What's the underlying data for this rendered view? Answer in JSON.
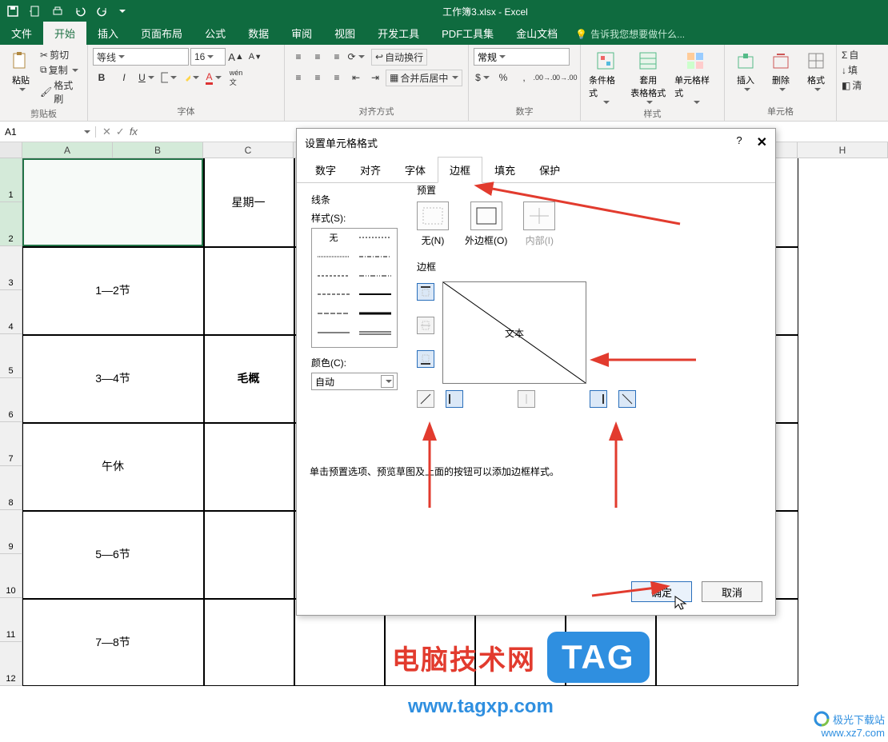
{
  "app": {
    "title": "工作簿3.xlsx - Excel"
  },
  "menutabs": {
    "file": "文件",
    "home": "开始",
    "insert": "插入",
    "pagelayout": "页面布局",
    "formulas": "公式",
    "data": "数据",
    "review": "审阅",
    "view": "视图",
    "dev": "开发工具",
    "pdf": "PDF工具集",
    "jinshan": "金山文档",
    "tell": "告诉我您想要做什么..."
  },
  "ribbon": {
    "clipboard": {
      "label": "剪贴板",
      "paste": "粘贴",
      "cut": "剪切",
      "copy": "复制",
      "brush": "格式刷"
    },
    "font": {
      "label": "字体",
      "name": "等线",
      "size": "16"
    },
    "align": {
      "label": "对齐方式",
      "wrap": "自动换行",
      "merge": "合并后居中"
    },
    "number": {
      "label": "数字",
      "format": "常规"
    },
    "styles": {
      "label": "样式",
      "cond": "条件格式",
      "tbl": "套用\n表格格式",
      "cell": "单元格样式"
    },
    "cells": {
      "label": "单元格",
      "ins": "插入",
      "del": "删除",
      "fmt": "格式"
    },
    "edit": {
      "sum": "自",
      "fill": "填",
      "clear": "清"
    }
  },
  "namebox": {
    "ref": "A1"
  },
  "columns": [
    "A",
    "B",
    "C",
    "",
    "",
    "",
    "",
    "H"
  ],
  "rows": [
    "1",
    "2",
    "3",
    "4",
    "5",
    "6",
    "7",
    "8",
    "9",
    "10",
    "11",
    "12"
  ],
  "sheet": {
    "c_day": "星期一",
    "r3": "1—2节",
    "r5": "3—4节",
    "r5c": "毛概",
    "r7": "午休",
    "r9": "5—6节",
    "r11": "7—8节"
  },
  "dialog": {
    "title": "设置单元格格式",
    "tabs": {
      "num": "数字",
      "align": "对齐",
      "font": "字体",
      "border": "边框",
      "fill": "填充",
      "protect": "保护"
    },
    "line": "线条",
    "style": "样式(S):",
    "none": "无",
    "color": "颜色(C):",
    "auto": "自动",
    "preset": "预置",
    "p_none": "无(N)",
    "p_out": "外边框(O)",
    "p_in": "内部(I)",
    "border_lbl": "边框",
    "sample": "文本",
    "hint": "单击预置选项、预览草图及上面的按钮可以添加边框样式。",
    "ok": "确定",
    "cancel": "取消",
    "help": "?"
  },
  "watermark": {
    "text": "电脑技术网",
    "tag": "TAG",
    "url": "www.tagxp.com",
    "jg1": "极光下载站",
    "jg2": "www.xz7.com"
  }
}
